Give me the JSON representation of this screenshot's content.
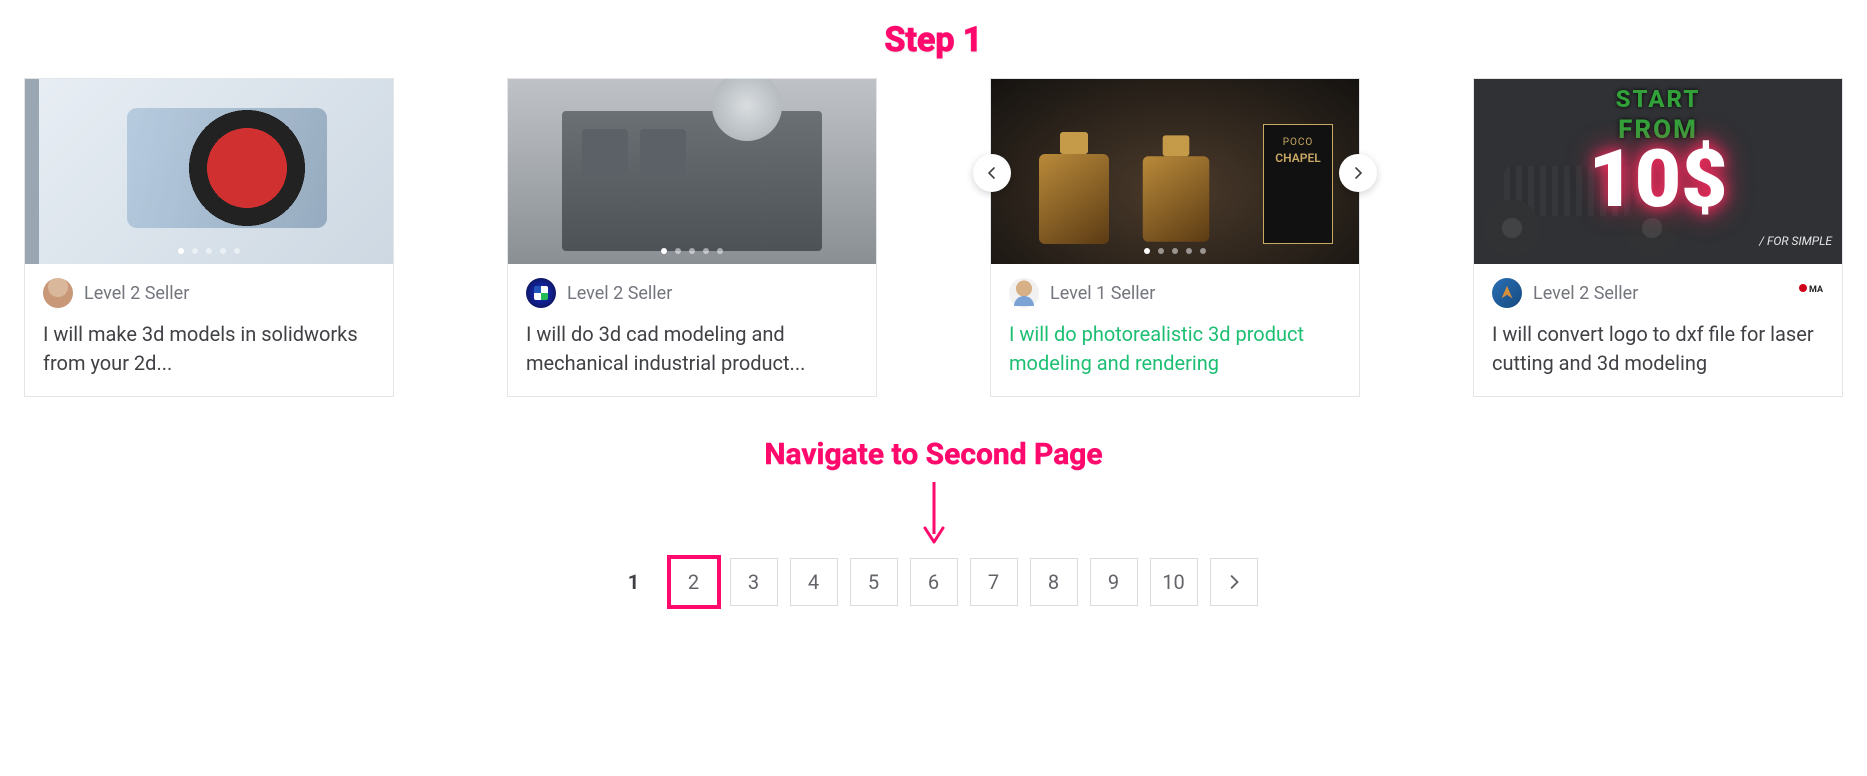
{
  "annotations": {
    "step_label": "Step 1",
    "nav_instruction": "Navigate to Second Page"
  },
  "cards": [
    {
      "seller_level": "Level 2 Seller",
      "title": "I will make 3d models in solidworks from your 2d...",
      "highlighted": false,
      "corner_badge": null
    },
    {
      "seller_level": "Level 2 Seller",
      "title": "I will do 3d cad modeling and mechanical industrial product...",
      "highlighted": false,
      "corner_badge": null
    },
    {
      "seller_level": "Level 1 Seller",
      "title": "I will do photorealistic 3d product modeling and rendering",
      "highlighted": true,
      "corner_badge": null
    },
    {
      "seller_level": "Level 2 Seller",
      "title": "I will convert logo to dxf file for laser cutting and 3d modeling",
      "highlighted": false,
      "corner_badge": "MAX"
    }
  ],
  "card4_image": {
    "line1": "START",
    "line2": "FROM",
    "price": "10$",
    "sub": "/ FOR SIMPLE"
  },
  "card3_box": {
    "brand1": "POCO",
    "brand2": "CHAPEL"
  },
  "pagination": {
    "pages": [
      "1",
      "2",
      "3",
      "4",
      "5",
      "6",
      "7",
      "8",
      "9",
      "10"
    ],
    "current": "1",
    "highlighted": "2"
  }
}
